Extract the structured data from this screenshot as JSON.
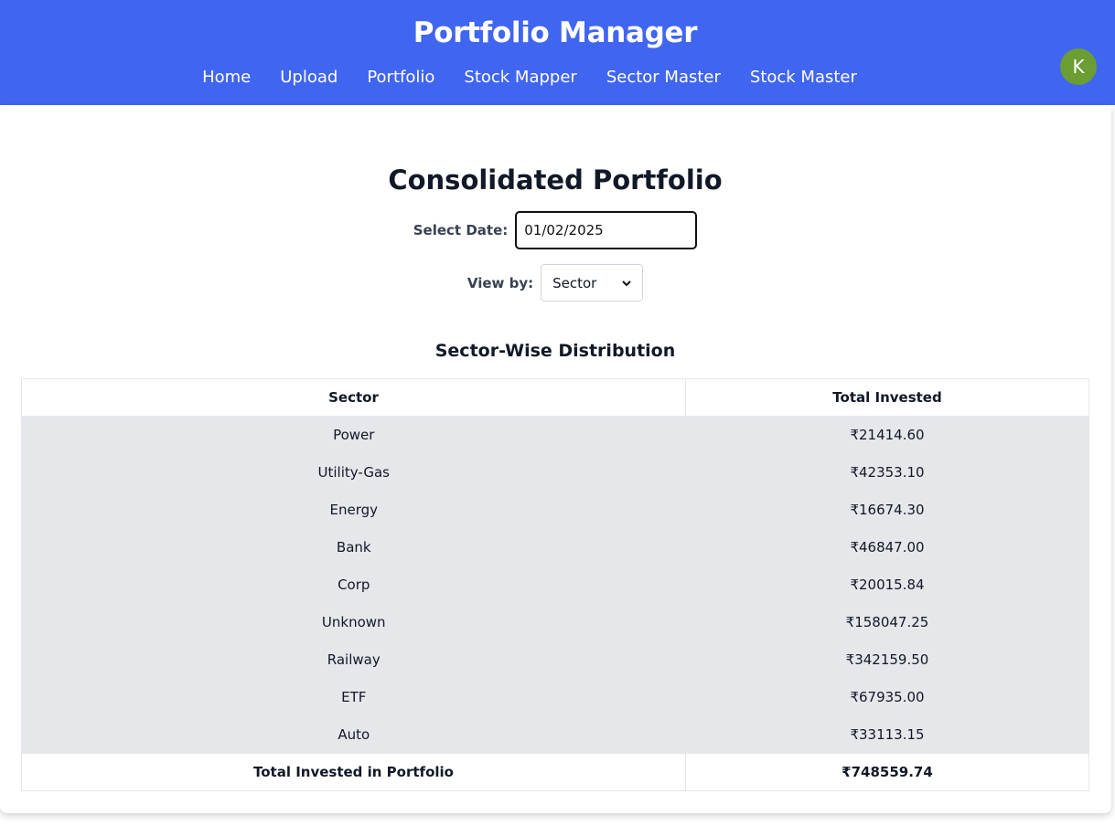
{
  "header": {
    "title": "Portfolio Manager",
    "nav": [
      "Home",
      "Upload",
      "Portfolio",
      "Stock Mapper",
      "Sector Master",
      "Stock Master"
    ],
    "avatar_initial": "K",
    "bg_color": "#4065f1"
  },
  "page": {
    "title": "Consolidated Portfolio",
    "date_label": "Select Date:",
    "date_value": "01/02/2025",
    "view_label": "View by:",
    "view_value": "Sector",
    "section_title": "Sector-Wise Distribution"
  },
  "table": {
    "headers": [
      "Sector",
      "Total Invested"
    ],
    "rows": [
      [
        "Power",
        "₹21414.60"
      ],
      [
        "Utility-Gas",
        "₹42353.10"
      ],
      [
        "Energy",
        "₹16674.30"
      ],
      [
        "Bank",
        "₹46847.00"
      ],
      [
        "Corp",
        "₹20015.84"
      ],
      [
        "Unknown",
        "₹158047.25"
      ],
      [
        "Railway",
        "₹342159.50"
      ],
      [
        "ETF",
        "₹67935.00"
      ],
      [
        "Auto",
        "₹33113.15"
      ]
    ],
    "footer": [
      "Total Invested in Portfolio",
      "₹748559.74"
    ]
  }
}
